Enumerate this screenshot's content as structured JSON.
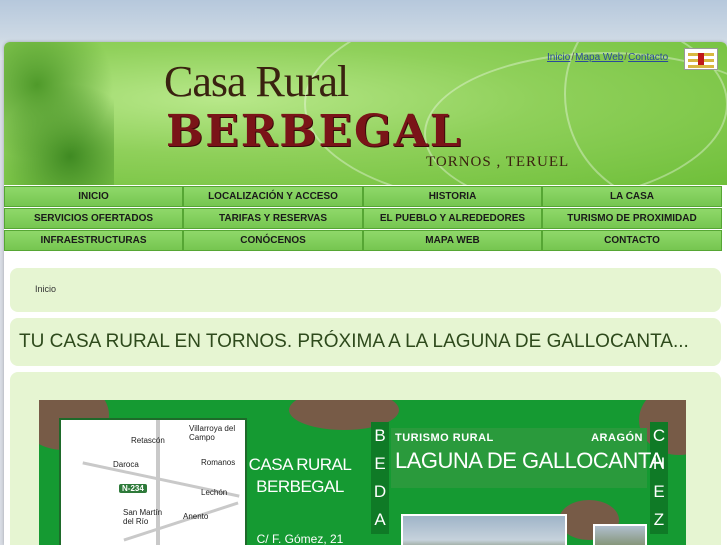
{
  "header": {
    "brand_top": "Casa Rural",
    "brand_main": "BERBEGAL",
    "brand_sub": "TORNOS , TERUEL",
    "toplinks": [
      "Inicio",
      "Mapa Web",
      "Contacto"
    ],
    "toplink_separator": "/",
    "flag_icon": "aragon-flag-icon"
  },
  "nav": {
    "rows": [
      [
        "INICIO",
        "LOCALIZACIÓN Y ACCESO",
        "HISTORIA",
        "LA CASA"
      ],
      [
        "SERVICIOS OFERTADOS",
        "TARIFAS Y RESERVAS",
        "EL PUEBLO Y ALREDEDORES",
        "TURISMO DE PROXIMIDAD"
      ],
      [
        "INFRAESTRUCTURAS",
        "CONÓCENOS",
        "MAPA WEB",
        "CONTACTO"
      ]
    ]
  },
  "breadcrumb": "Inicio",
  "page_title": "TU CASA RURAL EN TORNOS. PRÓXIMA A LA LAGUNA DE GALLOCANTA...",
  "banner": {
    "map_towns": [
      "Retascón",
      "Villarroya del Campo",
      "Daroca",
      "Romanos",
      "Lechón",
      "San Martín del Río",
      "Anento"
    ],
    "road_label": "N-234",
    "casa_line1": "CASA RURAL",
    "casa_line2": "BERBEGAL",
    "casa_addr": "C/ F. Gómez, 21",
    "left_letters": [
      "B",
      "E",
      "D",
      "A"
    ],
    "right_letters": [
      "C",
      "H",
      "E",
      "Z"
    ],
    "turismo_left": "TURISMO RURAL",
    "turismo_right": "ARAGÓN",
    "turismo_main": "LAGUNA DE GALLOCANTA"
  },
  "colors": {
    "nav_green": "#8fd86a",
    "panel_bg": "#e6f5d2",
    "brand_red": "#7a1418",
    "banner_green": "#159a32"
  }
}
